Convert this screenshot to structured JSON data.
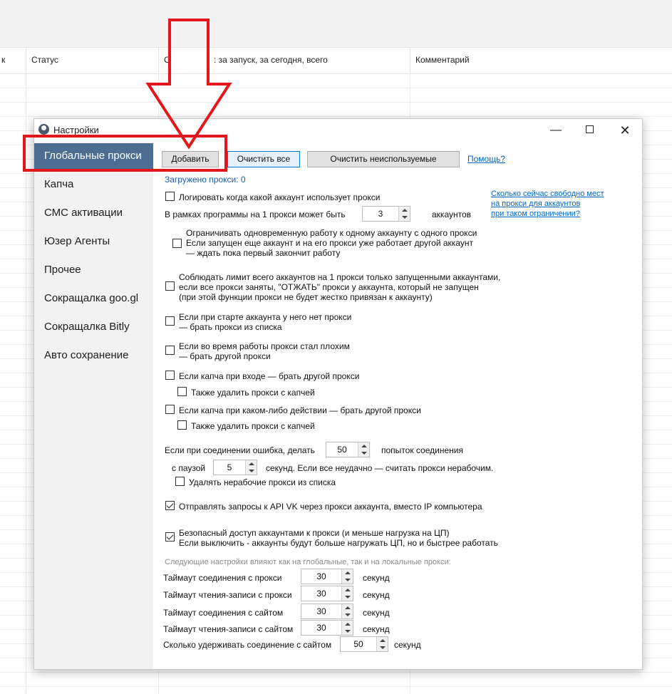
{
  "background": {
    "columns": [
      "к",
      "Статус",
      "С",
      ": за запуск, за сегодня, всего",
      "Комментарий"
    ]
  },
  "dialog": {
    "title": "Настройки",
    "window_buttons": {
      "minimize": "—",
      "maximize": "",
      "close": "✕"
    }
  },
  "sidebar": {
    "items": [
      {
        "label": "Глобальные прокси",
        "active": true
      },
      {
        "label": "Капча"
      },
      {
        "label": "СМС активации"
      },
      {
        "label": "Юзер Агенты"
      },
      {
        "label": "Прочее"
      },
      {
        "label": "Сокращалка goo.gl"
      },
      {
        "label": "Сокращалка Bitly"
      },
      {
        "label": "Авто сохранение"
      }
    ]
  },
  "toolbar": {
    "add_label": "Добавить",
    "clear_all_label": "Очистить все",
    "clear_unused_label": "Очистить неиспользуемые",
    "help_link": "Помощь?"
  },
  "status": {
    "loaded": "Загружено прокси: 0"
  },
  "settings": {
    "log_usage": {
      "label": "Логировать когда какой аккаунт использует прокси",
      "checked": false
    },
    "free_slots_link": [
      "Сколько сейчас свободно мест",
      "на прокси для аккаунтов",
      "при таком ограничении?"
    ],
    "per_proxy": {
      "prefix": "В рамках программы на 1 прокси может быть",
      "value": "3",
      "suffix": "аккаунтов"
    },
    "limit_one": {
      "lines": [
        "Ограничивать одновременную работу к одному аккаунту с одного прокси",
        "Если запущен еще аккаунт и на его прокси уже работает другой аккаунт",
        "— ждать пока первый закончит работу"
      ],
      "checked": false
    },
    "limit_running": {
      "lines": [
        "Соблюдать лимит всего аккаунтов на 1 прокси только запущенными аккаунтами,",
        "если все прокси заняты, \"ОТЖАТЬ\" прокси у аккаунта, который не запущен",
        "(при этой функции прокси не будет жестко привязан к аккаунту)"
      ],
      "checked": false
    },
    "no_proxy_start": {
      "lines": [
        "Если при старте аккаунта у него нет прокси",
        "— брать прокси из списка"
      ],
      "checked": false
    },
    "bad_proxy": {
      "lines": [
        "Если во время работы прокси стал плохим",
        "— брать другой прокси"
      ],
      "checked": false
    },
    "captcha_login": {
      "label": "Если капча при входе — брать другой прокси",
      "checked": false
    },
    "captcha_login_delete": {
      "label": "Также удалить прокси с капчей",
      "checked": false
    },
    "captcha_action": {
      "label": "Если капча при каком-либо действии — брать другой прокси",
      "checked": false
    },
    "captcha_action_delete": {
      "label": "Также удалить прокси с капчей",
      "checked": false
    },
    "retry": {
      "prefix": "Если при соединении ошибка, делать",
      "value": "50",
      "suffix": "попыток соединения"
    },
    "pause": {
      "prefix": "с паузой",
      "value": "5",
      "suffix": "секунд. Если все неудачно — считать прокси нерабочим."
    },
    "delete_bad": {
      "label": "Удалять нерабочие прокси из списка",
      "checked": false
    },
    "api_vk": {
      "label": "Отправлять запросы к API VK через прокси аккаунта, вместо IP компьютера",
      "checked": true
    },
    "safe_access": {
      "lines": [
        "Безопасный доступ аккаунтами к прокси (и меньше нагрузка на ЦП)",
        "Если выключить - аккаунты будут больше нагружать ЦП, но и быстрее работать"
      ],
      "checked": true
    },
    "note": "Следующие настройки влияют как на глобальные, так и на локальные прокси:",
    "timeouts": [
      {
        "label": "Таймаут соединения с прокси",
        "value": "30",
        "unit": "секунд"
      },
      {
        "label": "Таймаут чтения-записи с прокси",
        "value": "30",
        "unit": "секунд"
      },
      {
        "label": "Таймаут соединения с сайтом",
        "value": "30",
        "unit": "секунд"
      },
      {
        "label": "Таймаут чтения-записи с сайтом",
        "value": "30",
        "unit": "секунд"
      }
    ],
    "keep_alive": {
      "label": "Сколько удерживать соединение с сайтом",
      "value": "50",
      "unit": "секунд"
    }
  },
  "annotation": {
    "color": "#e3161b"
  }
}
